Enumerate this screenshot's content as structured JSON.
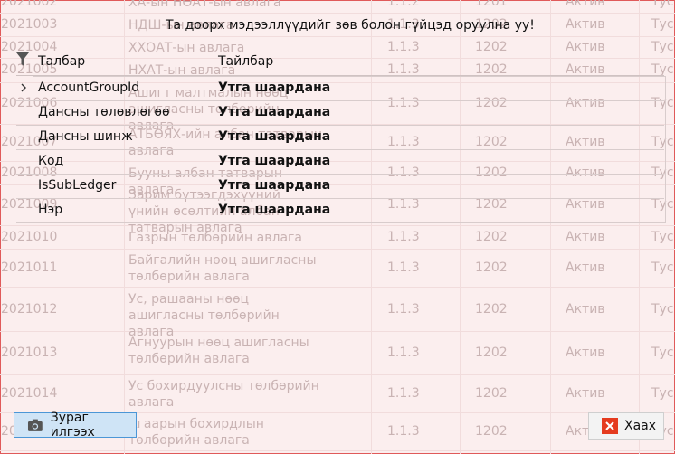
{
  "dialog": {
    "title": "Та доорх мэдээллүүдийг зөв болон гүйцэд оруулна уу!",
    "tree_header": {
      "col1": "Талбар",
      "col2": "Тайлбар"
    },
    "parent_row": {
      "label": "AccountGroupId",
      "value": "Утга шаардана"
    },
    "rows": [
      {
        "label": "Дансны төлөвлөгөө",
        "value": "Утга шаардана"
      },
      {
        "label": "Дансны шинж",
        "value": "Утга шаардана"
      },
      {
        "label": "Код",
        "value": "Утга шаардана"
      },
      {
        "label": "IsSubLedger",
        "value": "Утга шаардана"
      },
      {
        "label": "Нэр",
        "value": "Утга шаардана"
      }
    ],
    "send_button": "Зураг илгээх",
    "close_button": "Хаах"
  },
  "background_grid": {
    "rows": [
      {
        "code": "2021002",
        "desc": "ХА-ын НӨАТ-ын авлага",
        "ver": "1.1.2",
        "num": "1201",
        "status": "Актив",
        "extra": "Тус"
      },
      {
        "code": "2021003",
        "desc": "НДШ-ын авлага",
        "ver": "1.1.3",
        "num": "1202",
        "status": "Актив",
        "extra": "Тус"
      },
      {
        "code": "2021004",
        "desc": "ХХОАТ-ын авлага",
        "ver": "1.1.3",
        "num": "1202",
        "status": "Актив",
        "extra": "Тус"
      },
      {
        "code": "2021005",
        "desc": "НХАТ-ын авлага",
        "ver": "1.1.3",
        "num": "1202",
        "status": "Актив",
        "extra": "Тус"
      },
      {
        "code": "2021006",
        "desc": "Ашигт малтмалын нөөц ашигласны төлбөрийн авлага",
        "ver": "1.1.3",
        "num": "1202",
        "status": "Актив",
        "extra": "Тус"
      },
      {
        "code": "2021007",
        "desc": "АТБӨЯХ-ийн албан татварын авлага",
        "ver": "1.1.3",
        "num": "1202",
        "status": "Актив",
        "extra": "Тус"
      },
      {
        "code": "2021008",
        "desc": "Бууны албан татварын авлага",
        "ver": "1.1.3",
        "num": "1202",
        "status": "Актив",
        "extra": "Тус"
      },
      {
        "code": "2021009",
        "desc": "Зарим бүтээгдэхүүний үнийн өсөлтийн албан татварын авлага",
        "ver": "1.1.3",
        "num": "1202",
        "status": "Актив",
        "extra": "Тус"
      },
      {
        "code": "2021010",
        "desc": "Газрын төлбөрийн авлага",
        "ver": "1.1.3",
        "num": "1202",
        "status": "Актив",
        "extra": "Тус"
      },
      {
        "code": "2021011",
        "desc": "Байгалийн нөөц ашигласны төлбөрийн авлага",
        "ver": "1.1.3",
        "num": "1202",
        "status": "Актив",
        "extra": "Тус"
      },
      {
        "code": "2021012",
        "desc": "Ус, рашааны нөөц ашигласны төлбөрийн авлага",
        "ver": "1.1.3",
        "num": "1202",
        "status": "Актив",
        "extra": "Тус"
      },
      {
        "code": "2021013",
        "desc": "Агнуурын нөөц ашигласны төлбөрийн авлага",
        "ver": "1.1.3",
        "num": "1202",
        "status": "Актив",
        "extra": "Тус"
      },
      {
        "code": "2021014",
        "desc": "Ус бохирдуулсны төлбөрийн авлага",
        "ver": "1.1.3",
        "num": "1202",
        "status": "Актив",
        "extra": "Тус"
      },
      {
        "code": "2021015",
        "desc": "Агаарын бохирдлын төлбөрийн авлага",
        "ver": "1.1.3",
        "num": "1202",
        "status": "Актив",
        "extra": "Тус"
      }
    ]
  },
  "icons": {
    "filter": "filter-icon",
    "chevron": "chevron-right-icon",
    "camera": "camera-icon",
    "close": "close-icon"
  },
  "colors": {
    "accent": "#4b96d6",
    "close_red": "#e53b1f",
    "border_red": "#e05a5a"
  }
}
